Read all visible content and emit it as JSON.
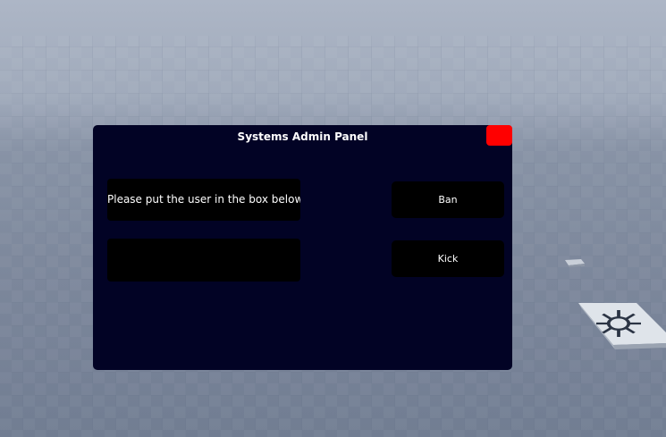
{
  "admin_panel": {
    "title": "Systems Admin Panel",
    "instruction_label": "Please put the user in the box below",
    "user_input": {
      "value": "",
      "placeholder": ""
    },
    "ban_label": "Ban",
    "kick_label": "Kick",
    "close_button_color": "#ff0000",
    "panel_color": "#020325"
  },
  "world": {
    "sky_color": "#aeb7c7",
    "baseplate_color": "#7d889c"
  }
}
